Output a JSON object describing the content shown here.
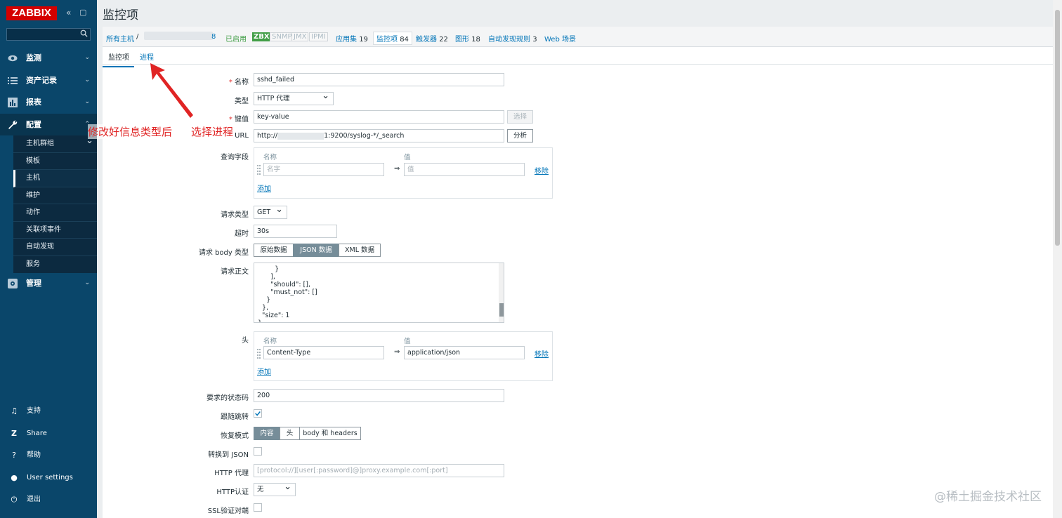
{
  "sidebar": {
    "logo": "ZABBIX",
    "menu": [
      {
        "label": "监测",
        "icon": "eye-icon"
      },
      {
        "label": "资产记录",
        "icon": "list-icon"
      },
      {
        "label": "报表",
        "icon": "bar-chart-icon"
      },
      {
        "label": "配置",
        "icon": "wrench-icon"
      },
      {
        "label": "管理",
        "icon": "gear-icon"
      }
    ],
    "config_items": [
      "主机群组",
      "模板",
      "主机",
      "维护",
      "动作",
      "关联项事件",
      "自动发现",
      "服务"
    ],
    "bottom": [
      {
        "label": "支持",
        "icon": "headset-icon"
      },
      {
        "label": "Share",
        "icon": "share-icon"
      },
      {
        "label": "帮助",
        "icon": "help-icon"
      },
      {
        "label": "User settings",
        "icon": "user-icon"
      },
      {
        "label": "退出",
        "icon": "power-icon"
      }
    ]
  },
  "page": {
    "title": "监控项"
  },
  "hostbar": {
    "all_hosts": "所有主机",
    "separator": "/",
    "host_suffix": "8",
    "enabled": "已启用",
    "zbx": "ZBX",
    "snmp": "SNMP",
    "jmx": "JMX",
    "ipmi": "IPMI",
    "apps": "应用集",
    "apps_count": "19",
    "items": "监控项",
    "items_count": "84",
    "triggers": "触发器",
    "triggers_count": "22",
    "graphs": "图形",
    "graphs_count": "18",
    "discovery": "自动发现规则",
    "discovery_count": "3",
    "web": "Web 场景"
  },
  "tabs": {
    "item": "监控项",
    "process": "进程"
  },
  "form": {
    "req_mark": "*",
    "name_label": "名称",
    "name_value": "sshd_failed",
    "type_label": "类型",
    "type_value": "HTTP 代理",
    "key_label": "键值",
    "key_value": "key-value",
    "select_btn": "选择",
    "url_label": "URL",
    "url_value_a": "http://",
    "url_value_b": "1:9200/syslog-*/_search",
    "parse_btn": "分析",
    "query_label": "查询字段",
    "col_name": "名称",
    "col_value": "值",
    "query_name_ph": "名字",
    "query_value_ph": "值",
    "eq": "⇒",
    "remove": "移除",
    "add": "添加",
    "method_label": "请求类型",
    "method_value": "GET",
    "timeout_label": "超时",
    "timeout_value": "30s",
    "body_type_label": "请求 body 类型",
    "body_types": [
      "原始数据",
      "JSON 数据",
      "XML 数据"
    ],
    "body_label": "请求正文",
    "body_text": "        }\n      ],\n      \"should\": [],\n      \"must_not\": []\n    }\n  },\n  \"size\": 1\n}",
    "headers_label": "头",
    "header_name": "Content-Type",
    "header_value": "application/json",
    "status_label": "要求的状态码",
    "status_value": "200",
    "follow_label": "跟随跳转",
    "retrieve_label": "恢复模式",
    "retrieve_modes": [
      "内容",
      "头",
      "body 和 headers"
    ],
    "convert_label": "转换到 JSON",
    "proxy_label": "HTTP 代理",
    "proxy_ph": "[protocol://][user[:password]@]proxy.example.com[:port]",
    "auth_label": "HTTP认证",
    "auth_value": "无",
    "ssl_label": "SSL验证对端"
  },
  "annotation": {
    "text1": "修改好信息类型后",
    "text2": "选择进程",
    "color": "#e02424"
  },
  "watermark": "@稀土掘金技术社区"
}
